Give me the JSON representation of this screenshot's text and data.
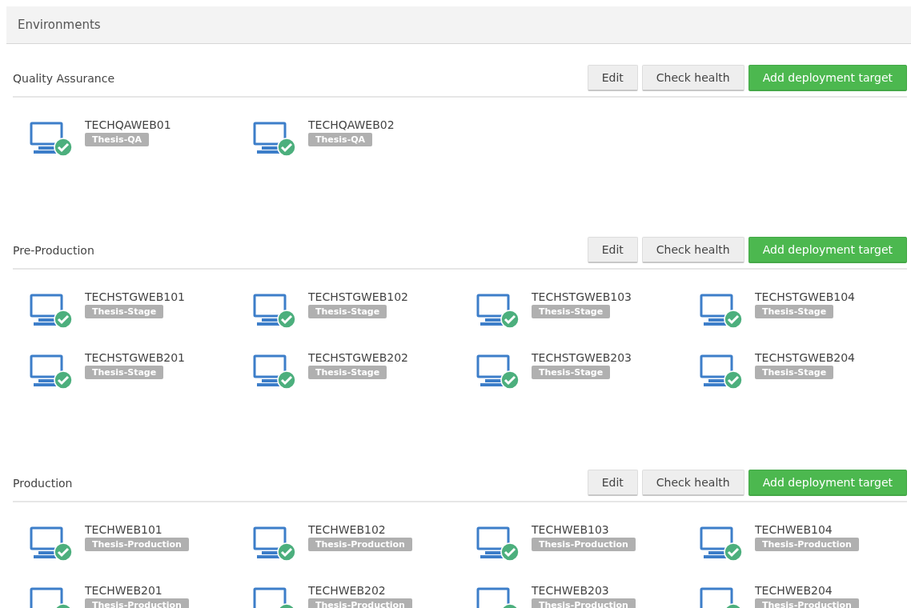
{
  "page": {
    "title": "Environments"
  },
  "environments": [
    {
      "name": "Quality Assurance",
      "buttons": [
        {
          "label": "Edit",
          "kind": "default"
        },
        {
          "label": "Check health",
          "kind": "default"
        },
        {
          "label": "Add deployment target",
          "kind": "primary"
        }
      ],
      "targets": [
        {
          "name": "TECHQAWEB01",
          "role": "Thesis-QA",
          "healthy": true
        },
        {
          "name": "TECHQAWEB02",
          "role": "Thesis-QA",
          "healthy": true
        }
      ]
    },
    {
      "name": "Pre-Production",
      "buttons": [
        {
          "label": "Edit",
          "kind": "default"
        },
        {
          "label": "Check health",
          "kind": "default"
        },
        {
          "label": "Add deployment target",
          "kind": "primary"
        }
      ],
      "targets": [
        {
          "name": "TECHSTGWEB101",
          "role": "Thesis-Stage",
          "healthy": true
        },
        {
          "name": "TECHSTGWEB102",
          "role": "Thesis-Stage",
          "healthy": true
        },
        {
          "name": "TECHSTGWEB103",
          "role": "Thesis-Stage",
          "healthy": true
        },
        {
          "name": "TECHSTGWEB104",
          "role": "Thesis-Stage",
          "healthy": true
        },
        {
          "name": "TECHSTGWEB201",
          "role": "Thesis-Stage",
          "healthy": true
        },
        {
          "name": "TECHSTGWEB202",
          "role": "Thesis-Stage",
          "healthy": true
        },
        {
          "name": "TECHSTGWEB203",
          "role": "Thesis-Stage",
          "healthy": true
        },
        {
          "name": "TECHSTGWEB204",
          "role": "Thesis-Stage",
          "healthy": true
        }
      ]
    },
    {
      "name": "Production",
      "buttons": [
        {
          "label": "Edit",
          "kind": "default"
        },
        {
          "label": "Check health",
          "kind": "default"
        },
        {
          "label": "Add deployment target",
          "kind": "primary"
        }
      ],
      "targets": [
        {
          "name": "TECHWEB101",
          "role": "Thesis-Production",
          "healthy": true
        },
        {
          "name": "TECHWEB102",
          "role": "Thesis-Production",
          "healthy": true
        },
        {
          "name": "TECHWEB103",
          "role": "Thesis-Production",
          "healthy": true
        },
        {
          "name": "TECHWEB104",
          "role": "Thesis-Production",
          "healthy": true
        },
        {
          "name": "TECHWEB201",
          "role": "Thesis-Production",
          "healthy": true
        },
        {
          "name": "TECHWEB202",
          "role": "Thesis-Production",
          "healthy": true
        },
        {
          "name": "TECHWEB203",
          "role": "Thesis-Production",
          "healthy": true
        },
        {
          "name": "TECHWEB204",
          "role": "Thesis-Production",
          "healthy": true
        }
      ]
    }
  ]
}
